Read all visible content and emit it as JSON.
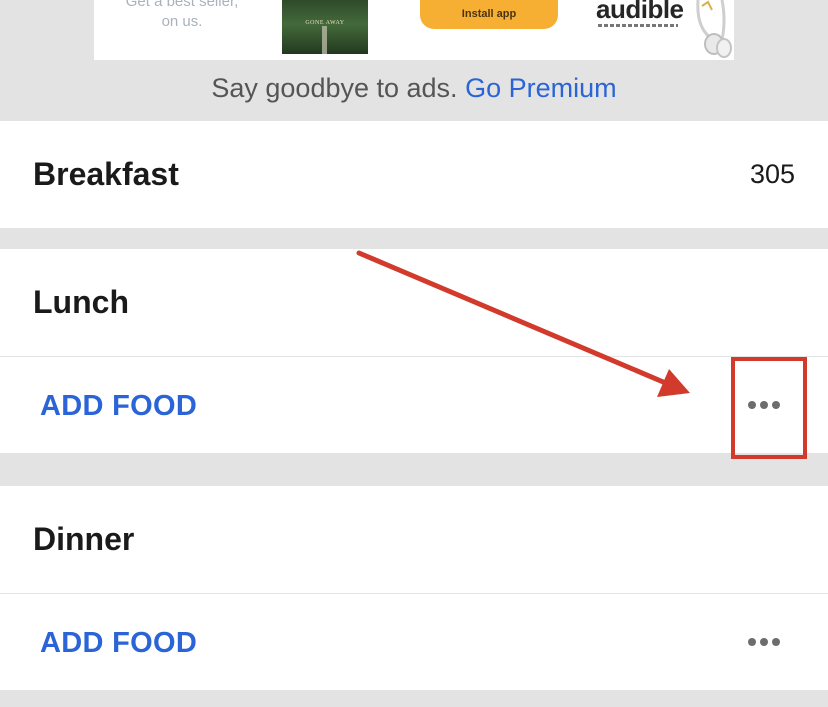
{
  "ad": {
    "text": "Get a best seller,\non us.",
    "book_title": "GONE AWAY",
    "install_label": "Install app",
    "brand": "audible"
  },
  "premium": {
    "text": "Say goodbye to ads.",
    "link": "Go Premium"
  },
  "meals": {
    "breakfast": {
      "title": "Breakfast",
      "calories": "305"
    },
    "lunch": {
      "title": "Lunch",
      "add_label": "ADD FOOD"
    },
    "dinner": {
      "title": "Dinner",
      "add_label": "ADD FOOD"
    }
  },
  "icons": {
    "more": "more-horizontal-icon"
  },
  "colors": {
    "accent": "#2a64d6",
    "annotation": "#d23b2c",
    "background": "#e3e3e3",
    "install_button": "#f6ae33"
  }
}
